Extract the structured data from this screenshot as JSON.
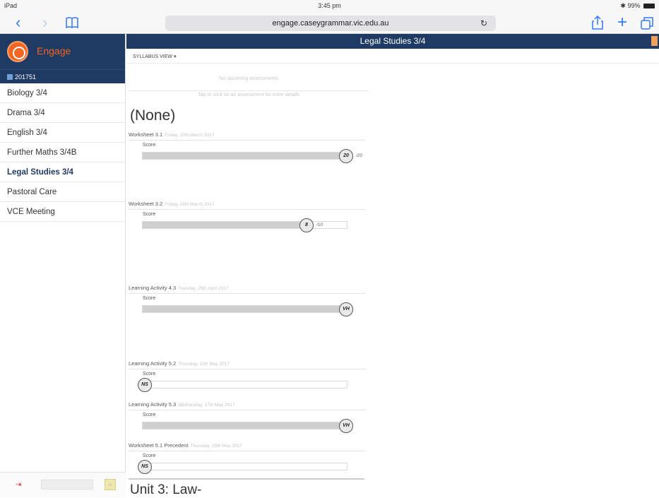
{
  "status": {
    "device": "iPad",
    "time": "3:45 pm",
    "battery": "99%"
  },
  "browser": {
    "url": "engage.caseygrammar.vic.edu.au"
  },
  "sidebar": {
    "brand": "Engage",
    "year": "201751",
    "subjects": [
      {
        "label": "Biology 3/4"
      },
      {
        "label": "Drama 3/4"
      },
      {
        "label": "English 3/4"
      },
      {
        "label": "Further Maths 3/4B"
      },
      {
        "label": "Legal Studies 3/4"
      },
      {
        "label": "Pastoral Care"
      },
      {
        "label": "VCE Meeting"
      }
    ]
  },
  "main": {
    "title": "Legal Studies 3/4",
    "syllabus_view": "SYLLABUS VIEW ▾",
    "no_upcoming": "No upcoming assessments",
    "tap_hint": "Tap or click on an assessment for more details",
    "none_heading": "(None)",
    "unit_heading": "Unit 3: Law-",
    "assessments": [
      {
        "title": "Worksheet 3.1",
        "date": "Friday, 10th March 2017",
        "score_label": "Score",
        "badge": "20",
        "out_of": "/20",
        "fill": 1.0
      },
      {
        "title": "Worksheet 3.2",
        "date": "Friday, 24th March 2017",
        "score_label": "Score",
        "badge": "8",
        "out_of": "/10",
        "fill": 0.8
      },
      {
        "title": "Learning Activity 4.3",
        "date": "Tuesday, 25th April 2017",
        "score_label": "Score",
        "badge": "VH",
        "out_of": "",
        "fill": 1.0
      },
      {
        "title": "Learning Activity 5.2",
        "date": "Thursday, 11th May 2017",
        "score_label": "Score",
        "badge": "NS",
        "out_of": "",
        "fill": 0.0
      },
      {
        "title": "Learning Activity 5.3",
        "date": "Wednesday, 17th May 2017",
        "score_label": "Score",
        "badge": "VH",
        "out_of": "",
        "fill": 1.0
      },
      {
        "title": "Worksheet 5.1 Precedent",
        "date": "Thursday, 25th May 2017",
        "score_label": "Score",
        "badge": "NS",
        "out_of": "",
        "fill": 0.0
      }
    ]
  },
  "colors": {
    "navy": "#1f3a63",
    "accent": "#f26522"
  }
}
